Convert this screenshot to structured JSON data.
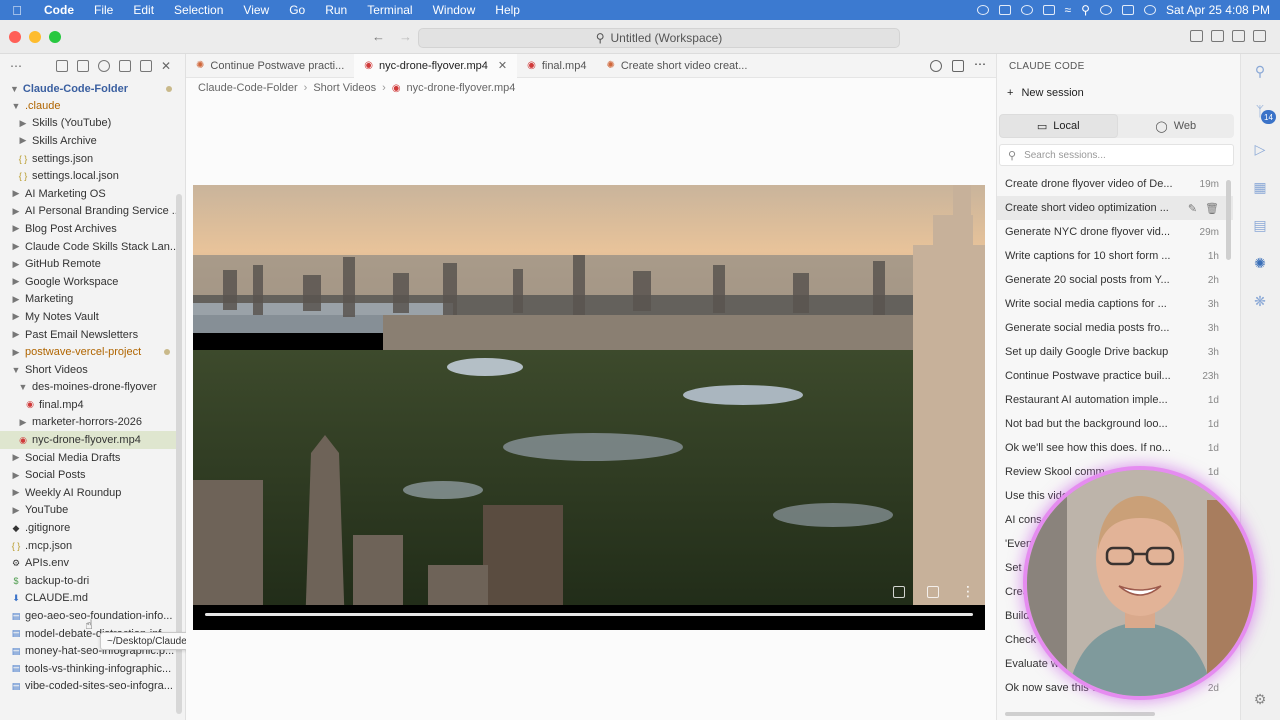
{
  "menubar": {
    "app_name": "Code",
    "menus": [
      "File",
      "Edit",
      "Selection",
      "View",
      "Go",
      "Run",
      "Terminal",
      "Window",
      "Help"
    ],
    "clock": "Sat Apr 25  4:08 PM"
  },
  "titlebar": {
    "command_center": "Untitled (Workspace)"
  },
  "explorer": {
    "root": "Claude-Code-Folder",
    "items": [
      {
        "label": ".claude",
        "kind": "folder",
        "open": true,
        "depth": 1,
        "color": "orange"
      },
      {
        "label": "Skills (YouTube)",
        "kind": "folder",
        "open": false,
        "depth": 2
      },
      {
        "label": "Skills Archive",
        "kind": "folder",
        "open": false,
        "depth": 2
      },
      {
        "label": "settings.json",
        "kind": "json",
        "depth": 2
      },
      {
        "label": "settings.local.json",
        "kind": "json",
        "depth": 2
      },
      {
        "label": "AI Marketing OS",
        "kind": "folder",
        "open": false,
        "depth": 1
      },
      {
        "label": "AI Personal Branding Service ...",
        "kind": "folder",
        "open": false,
        "depth": 1
      },
      {
        "label": "Blog Post Archives",
        "kind": "folder",
        "open": false,
        "depth": 1
      },
      {
        "label": "Claude Code Skills Stack Lan...",
        "kind": "folder",
        "open": false,
        "depth": 1
      },
      {
        "label": "GitHub Remote",
        "kind": "folder",
        "open": false,
        "depth": 1
      },
      {
        "label": "Google Workspace",
        "kind": "folder",
        "open": false,
        "depth": 1
      },
      {
        "label": "Marketing",
        "kind": "folder",
        "open": false,
        "depth": 1
      },
      {
        "label": "My Notes Vault",
        "kind": "folder",
        "open": false,
        "depth": 1
      },
      {
        "label": "Past Email Newsletters",
        "kind": "folder",
        "open": false,
        "depth": 1
      },
      {
        "label": "postwave-vercel-project",
        "kind": "folder",
        "open": false,
        "depth": 1,
        "color": "orange",
        "modified": true
      },
      {
        "label": "Short Videos",
        "kind": "folder",
        "open": true,
        "depth": 1
      },
      {
        "label": "des-moines-drone-flyover",
        "kind": "folder",
        "open": true,
        "depth": 2
      },
      {
        "label": "final.mp4",
        "kind": "video",
        "depth": 3
      },
      {
        "label": "marketer-horrors-2026",
        "kind": "folder",
        "open": false,
        "depth": 2
      },
      {
        "label": "nyc-drone-flyover.mp4",
        "kind": "video",
        "depth": 2,
        "selected": true
      },
      {
        "label": "Social Media Drafts",
        "kind": "folder",
        "open": false,
        "depth": 1
      },
      {
        "label": "Social Posts",
        "kind": "folder",
        "open": false,
        "depth": 1
      },
      {
        "label": "Weekly AI Roundup",
        "kind": "folder",
        "open": false,
        "depth": 1
      },
      {
        "label": "YouTube",
        "kind": "folder",
        "open": false,
        "depth": 1
      },
      {
        "label": ".gitignore",
        "kind": "git",
        "depth": 1
      },
      {
        "label": ".mcp.json",
        "kind": "json",
        "depth": 1
      },
      {
        "label": "APIs.env",
        "kind": "env",
        "depth": 1
      },
      {
        "label": "backup-to-dri",
        "kind": "script",
        "depth": 1
      },
      {
        "label": "CLAUDE.md",
        "kind": "md",
        "depth": 1
      },
      {
        "label": "geo-aeo-seo-foundation-info...",
        "kind": "image",
        "depth": 1
      },
      {
        "label": "model-debate-distraction-inf...",
        "kind": "image",
        "depth": 1
      },
      {
        "label": "money-hat-seo-infographic.p...",
        "kind": "image",
        "depth": 1
      },
      {
        "label": "tools-vs-thinking-infographic...",
        "kind": "image",
        "depth": 1
      },
      {
        "label": "vibe-coded-sites-seo-infogra...",
        "kind": "image",
        "depth": 1
      }
    ],
    "tooltip": "~/Desktop/Claude-Code-Folder/APIs.env"
  },
  "editor": {
    "tabs": [
      {
        "label": "Continue Postwave practi...",
        "icon": "claude",
        "active": false
      },
      {
        "label": "nyc-drone-flyover.mp4",
        "icon": "video",
        "active": true
      },
      {
        "label": "final.mp4",
        "icon": "video",
        "active": false
      },
      {
        "label": "Create short video creat...",
        "icon": "claude",
        "active": false
      }
    ],
    "breadcrumb": [
      "Claude-Code-Folder",
      "Short Videos",
      "nyc-drone-flyover.mp4"
    ],
    "video": {
      "progress": 1.0
    }
  },
  "claude_panel": {
    "header": "CLAUDE CODE",
    "new_session": "New session",
    "tabs": [
      "Local",
      "Web"
    ],
    "active_tab": "Local",
    "search_placeholder": "Search sessions...",
    "sessions": [
      {
        "title": "Create drone flyover video of De...",
        "time": "19m"
      },
      {
        "title": "Create short video optimization ...",
        "time": "",
        "hover": true
      },
      {
        "title": "Generate NYC drone flyover vid...",
        "time": "29m"
      },
      {
        "title": "Write captions for 10 short form ...",
        "time": "1h"
      },
      {
        "title": "Generate 20 social posts from Y...",
        "time": "2h"
      },
      {
        "title": "Write social media captions for ...",
        "time": "3h"
      },
      {
        "title": "Generate social media posts fro...",
        "time": "3h"
      },
      {
        "title": "Set up daily Google Drive backup",
        "time": "3h"
      },
      {
        "title": "Continue Postwave practice buil...",
        "time": "23h"
      },
      {
        "title": "Restaurant AI automation imple...",
        "time": "1d"
      },
      {
        "title": "Not bad but the background loo...",
        "time": "1d"
      },
      {
        "title": "Ok we'll see how this does. If no...",
        "time": "1d"
      },
      {
        "title": "Review Skool comm",
        "time": "1d"
      },
      {
        "title": "Use this vide",
        "time": ""
      },
      {
        "title": "AI cons",
        "time": ""
      },
      {
        "title": "'Every",
        "time": ""
      },
      {
        "title": "Set u",
        "time": ""
      },
      {
        "title": "Crea",
        "time": ""
      },
      {
        "title": "Build",
        "time": ""
      },
      {
        "title": "Check N",
        "time": ""
      },
      {
        "title": "Evaluate we",
        "time": ""
      },
      {
        "title": "Ok now save this co",
        "time": "2d"
      }
    ]
  },
  "activity_bar": {
    "badge": "14"
  }
}
